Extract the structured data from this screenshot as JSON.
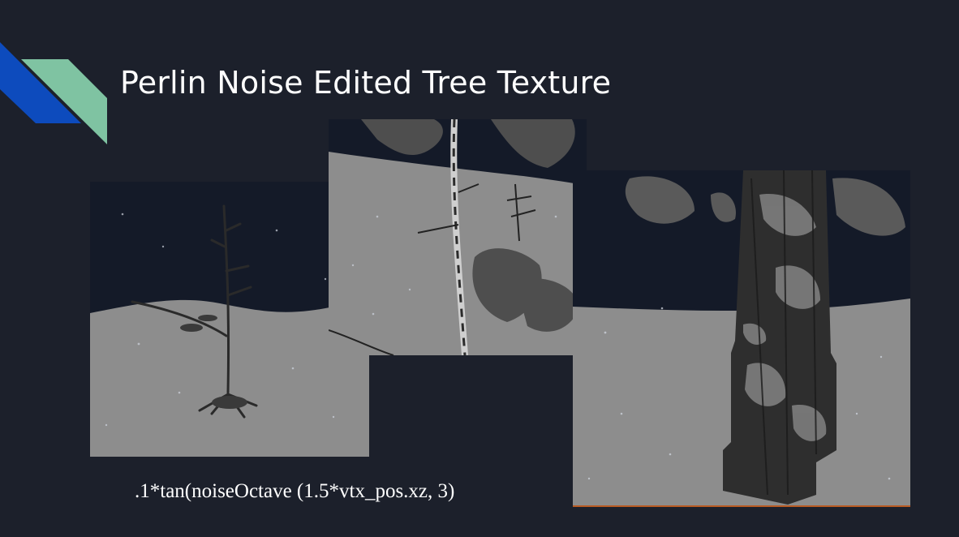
{
  "slide": {
    "title": "Perlin Noise Edited Tree Texture",
    "formula": ".1*tan(noiseOctave (1.5*vtx_pos.xz, 3)"
  },
  "colors": {
    "background": "#1c202b",
    "accent_blue": "#0d4bbd",
    "accent_teal": "#7fc3a2",
    "sky": "#141a28",
    "snow": "#8d8d8d",
    "rule": "#b85a23"
  },
  "images": [
    {
      "id": "sapling-far",
      "icon": "tree-render-image"
    },
    {
      "id": "sapling-near",
      "icon": "tree-render-image"
    },
    {
      "id": "trunk-closeup",
      "icon": "tree-render-image"
    }
  ]
}
